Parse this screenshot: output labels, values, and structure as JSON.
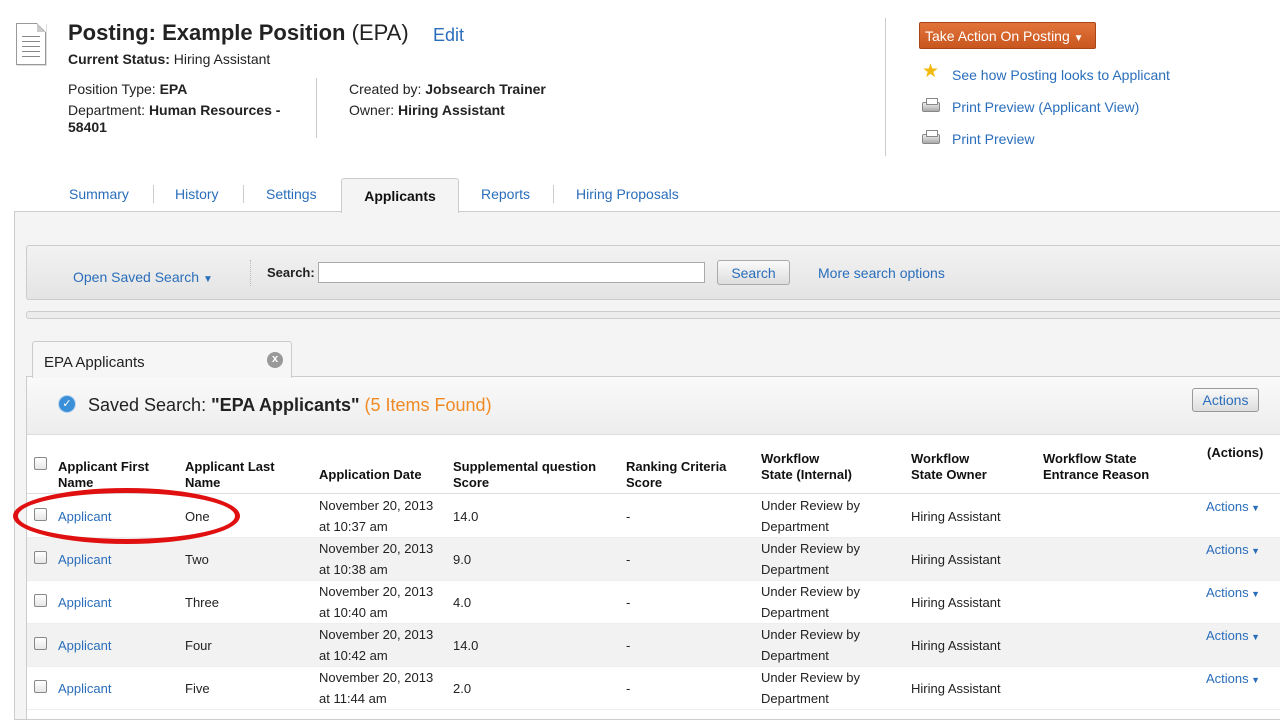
{
  "posting": {
    "title_prefix": "Posting: ",
    "title_name": "Example Position",
    "title_code": "(EPA)",
    "edit": "Edit",
    "status_label": "Current Status:",
    "status_value": "Hiring Assistant",
    "position_type_label": "Position Type:",
    "position_type_value": "EPA",
    "department_label": "Department:",
    "department_value_line1": "Human Resources -",
    "department_value_line2": "58401",
    "created_by_label": "Created by:",
    "created_by_value": "Jobsearch Trainer",
    "owner_label": "Owner:",
    "owner_value": "Hiring Assistant"
  },
  "side_actions": {
    "take_action": "Take Action On Posting",
    "links": [
      {
        "label": "See how Posting looks to Applicant",
        "icon": "star-icon"
      },
      {
        "label": "Print Preview (Applicant View)",
        "icon": "printer-icon"
      },
      {
        "label": "Print Preview",
        "icon": "printer-icon"
      }
    ]
  },
  "tabs": [
    {
      "label": "Summary"
    },
    {
      "label": "History"
    },
    {
      "label": "Settings"
    },
    {
      "label": "Applicants",
      "active": true
    },
    {
      "label": "Reports"
    },
    {
      "label": "Hiring Proposals"
    }
  ],
  "search": {
    "open_saved": "Open Saved Search",
    "label": "Search:",
    "value": "",
    "placeholder": "",
    "button": "Search",
    "more_options": "More search options"
  },
  "saved_tab": {
    "label": "EPA Applicants",
    "close": "x"
  },
  "results": {
    "prefix": "Saved Search: ",
    "name": "\"EPA Applicants\"",
    "count": "(5 Items Found)",
    "actions_button": "Actions"
  },
  "table": {
    "headers": {
      "first_line1": "Applicant First",
      "first_line2": "Name",
      "last_line1": "Applicant Last",
      "last_line2": "Name",
      "date": "Application Date",
      "supp_line1": "Supplemental question",
      "supp_line2": "Score",
      "rank_line1": "Ranking Criteria",
      "rank_line2": "Score",
      "wf_line1": "Workflow",
      "wf_line2": "State (Internal)",
      "owner_line1": "Workflow",
      "owner_line2": "State Owner",
      "reason_line1": "Workflow State",
      "reason_line2": "Entrance Reason",
      "actions": "(Actions)"
    },
    "rows": [
      {
        "first": "Applicant",
        "last": "One",
        "date1": "November 20, 2013",
        "date2": "at 10:37 am",
        "supp": "14.0",
        "rank": "-",
        "wf1": "Under Review by",
        "wf2": "Department",
        "owner": "Hiring Assistant",
        "reason": "",
        "actions": "Actions"
      },
      {
        "first": "Applicant",
        "last": "Two",
        "date1": "November 20, 2013",
        "date2": "at 10:38 am",
        "supp": "9.0",
        "rank": "-",
        "wf1": "Under Review by",
        "wf2": "Department",
        "owner": "Hiring Assistant",
        "reason": "",
        "actions": "Actions"
      },
      {
        "first": "Applicant",
        "last": "Three",
        "date1": "November 20, 2013",
        "date2": "at 10:40 am",
        "supp": "4.0",
        "rank": "-",
        "wf1": "Under Review by",
        "wf2": "Department",
        "owner": "Hiring Assistant",
        "reason": "",
        "actions": "Actions"
      },
      {
        "first": "Applicant",
        "last": "Four",
        "date1": "November 20, 2013",
        "date2": "at 10:42 am",
        "supp": "14.0",
        "rank": "-",
        "wf1": "Under Review by",
        "wf2": "Department",
        "owner": "Hiring Assistant",
        "reason": "",
        "actions": "Actions"
      },
      {
        "first": "Applicant",
        "last": "Five",
        "date1": "November 20, 2013",
        "date2": "at 11:44 am",
        "supp": "2.0",
        "rank": "-",
        "wf1": "Under Review by",
        "wf2": "Department",
        "owner": "Hiring Assistant",
        "reason": "",
        "actions": "Actions"
      }
    ]
  },
  "colors": {
    "link": "#2a6ebb",
    "take_action_bg": "#d0602a",
    "found_count": "#f08a24",
    "highlight": "#e01010"
  }
}
